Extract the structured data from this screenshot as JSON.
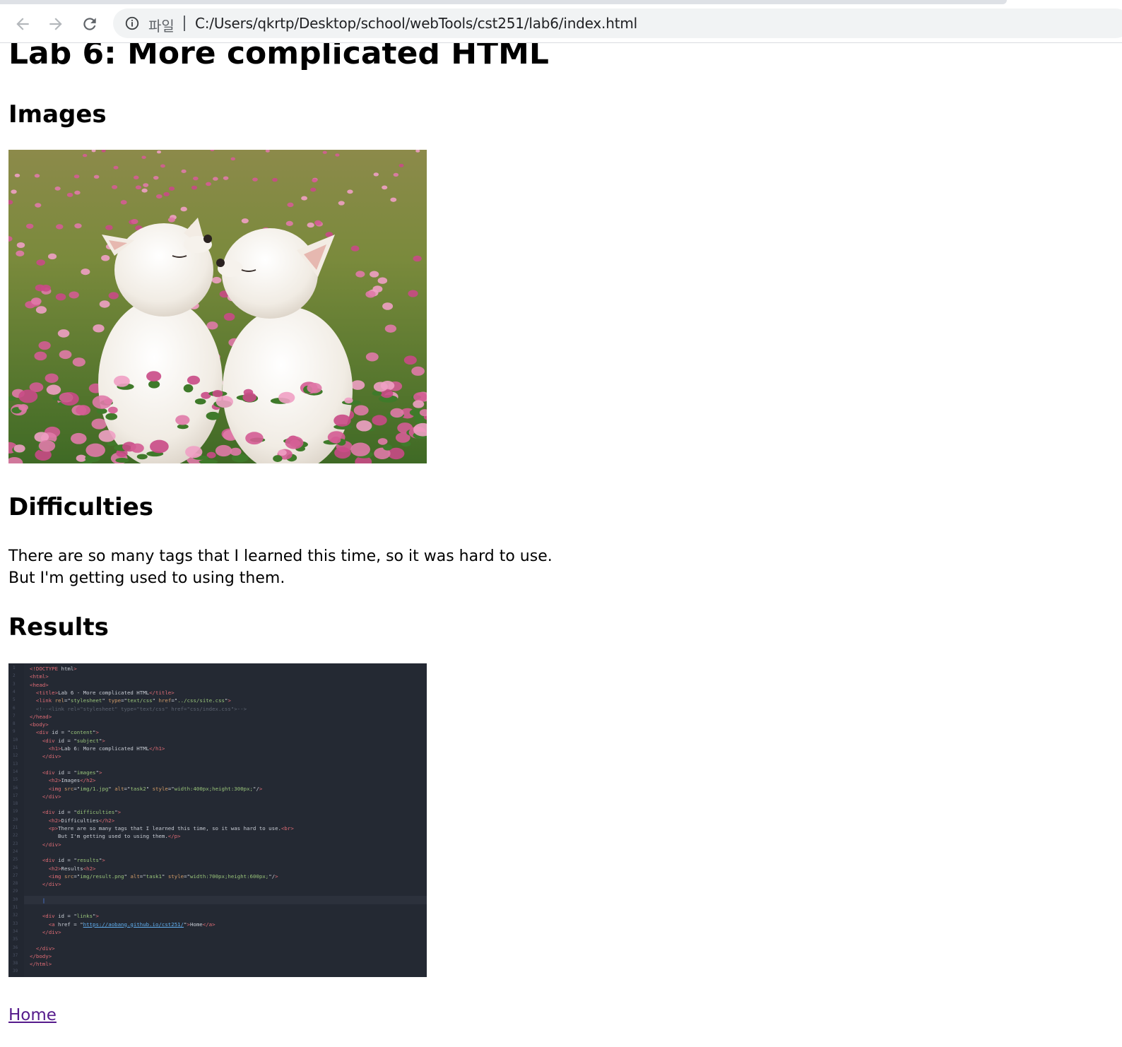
{
  "browser": {
    "scheme_label": "파일",
    "url": "C:/Users/qkrtp/Desktop/school/webTools/cst251/lab6/index.html"
  },
  "page": {
    "title": "Lab 6: More complicated HTML",
    "images_heading": "Images",
    "difficulties_heading": "Difficulties",
    "difficulties_line1": "There are so many tags that I learned this time, so it was hard to use.",
    "difficulties_line2": "But I'm getting used to using them.",
    "results_heading": "Results",
    "home_link": "Home"
  },
  "code_screenshot": {
    "lines": [
      "<!DOCTYPE html>",
      "<html>",
      "<head>",
      "  <title>Lab 6 - More complicated HTML</title>",
      "  <link rel=\"stylesheet\" type=\"text/css\" href=\"../css/site.css\">",
      "  <!--<link rel=\"stylesheet\" type=\"text/css\" href=\"css/index.css\">-->",
      "</head>",
      "<body>",
      "  <div id = \"content\">",
      "    <div id = \"subject\">",
      "      <h1>Lab 6: More complicated HTML</h1>",
      "    </div>",
      "",
      "    <div id = \"images\">",
      "      <h2>Images</h2>",
      "      <img src=\"img/1.jpg\" alt=\"task2\" style=\"width:400px;height:300px;\"/>",
      "    </div>",
      "",
      "    <div id = \"difficulties\">",
      "      <h2>Difficulties</h2>",
      "      <p>There are so many tags that I learned this time, so it was hard to use.<br>",
      "         But I'm getting used to using them.</p>",
      "    </div>",
      "",
      "    <div id = \"results\">",
      "      <h2>Results<h2>",
      "      <img src=\"img/result.png\" alt=\"task1\" style=\"width:700px;height:600px;\"/>",
      "    </div>",
      "",
      "    |",
      "",
      "    <div id = \"links\">",
      "      <a href = \"https://aobang.github.io/cst251/\">Home</a>",
      "    </div>",
      "",
      "  </div>",
      "</body>",
      "</html>",
      ""
    ]
  },
  "colors": {
    "link_visited": "#551a8b",
    "code_background": "#242933",
    "omnibox_background": "#f1f3f4"
  },
  "icons": [
    "back-arrow-icon",
    "forward-arrow-icon",
    "reload-icon",
    "info-icon"
  ]
}
